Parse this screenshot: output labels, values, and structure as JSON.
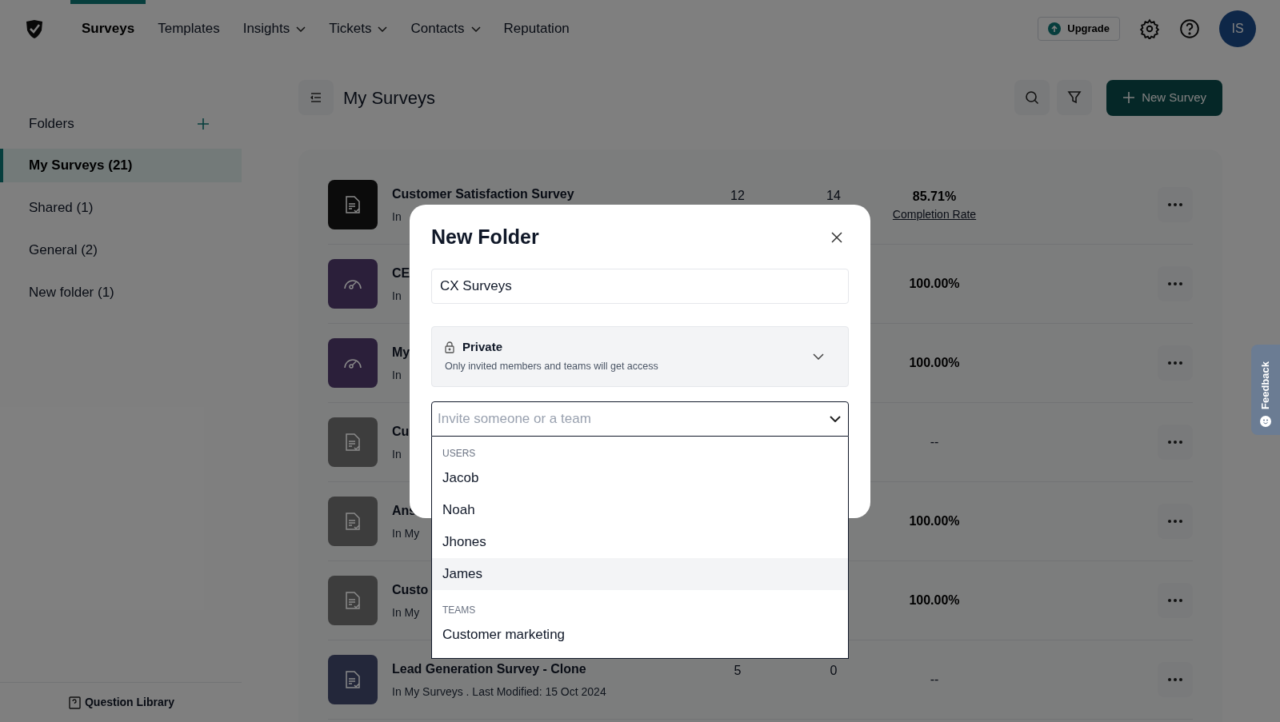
{
  "nav": {
    "items": [
      {
        "label": "Surveys",
        "selected": true,
        "dropdown": false
      },
      {
        "label": "Templates",
        "selected": false,
        "dropdown": false
      },
      {
        "label": "Insights",
        "selected": false,
        "dropdown": true
      },
      {
        "label": "Tickets",
        "selected": false,
        "dropdown": true
      },
      {
        "label": "Contacts",
        "selected": false,
        "dropdown": true
      },
      {
        "label": "Reputation",
        "selected": false,
        "dropdown": false
      }
    ],
    "upgrade": "Upgrade",
    "avatar": "IS"
  },
  "sidebar": {
    "title": "Folders",
    "items": [
      {
        "label": "My Surveys (21)",
        "selected": true
      },
      {
        "label": "Shared (1)",
        "selected": false
      },
      {
        "label": "General (2)",
        "selected": false
      },
      {
        "label": "New folder (1)",
        "selected": false
      }
    ],
    "footer": "Question Library"
  },
  "main": {
    "title": "My Surveys",
    "new_button": "New Survey",
    "rows": [
      {
        "title": "Customer Satisfaction Survey",
        "subtitle": "In",
        "kind": "document",
        "color": "#0b0b0b",
        "column_2": "12",
        "column_3": "14",
        "rate": "85.71%",
        "rate_label": "Completion Rate"
      },
      {
        "title": "CE",
        "subtitle": "In",
        "kind": "gauge",
        "color": "#2b1f3a",
        "rate": "100.00%"
      },
      {
        "title": "My",
        "subtitle": "In",
        "kind": "gauge",
        "color": "#2b1f3a",
        "rate": "100.00%"
      },
      {
        "title": "Cu",
        "subtitle": "In",
        "kind": "document",
        "color": "#3d3d3d",
        "rate": "--"
      },
      {
        "title": "Ans",
        "subtitle": "In My",
        "kind": "document",
        "color": "#3d3d3d",
        "rate": "100.00%"
      },
      {
        "title": "Custo",
        "subtitle": "In My",
        "kind": "document",
        "color": "#3d3d3d",
        "rate": "100.00%"
      },
      {
        "title": "Lead Generation Survey - Clone",
        "subtitle": "In My Surveys . Last Modified: 15 Oct 2024",
        "kind": "document",
        "color": "#23273a",
        "column_2": "5",
        "column_3": "0",
        "rate": "--"
      }
    ]
  },
  "modal": {
    "title": "New Folder",
    "name_value": "CX Surveys",
    "access": {
      "label": "Private",
      "description": "Only invited members and teams will get access"
    },
    "invite": {
      "placeholder": "Invite someone or a team"
    },
    "groups": [
      {
        "heading": "USERS",
        "options": [
          {
            "label": "Jacob",
            "highlighted": false
          },
          {
            "label": "Noah",
            "highlighted": false
          },
          {
            "label": "Jhones",
            "highlighted": false
          },
          {
            "label": "James",
            "highlighted": true
          }
        ]
      },
      {
        "heading": "TEAMS",
        "options": [
          {
            "label": "Customer marketing",
            "highlighted": false
          }
        ]
      }
    ]
  },
  "feedback": "Feedback"
}
